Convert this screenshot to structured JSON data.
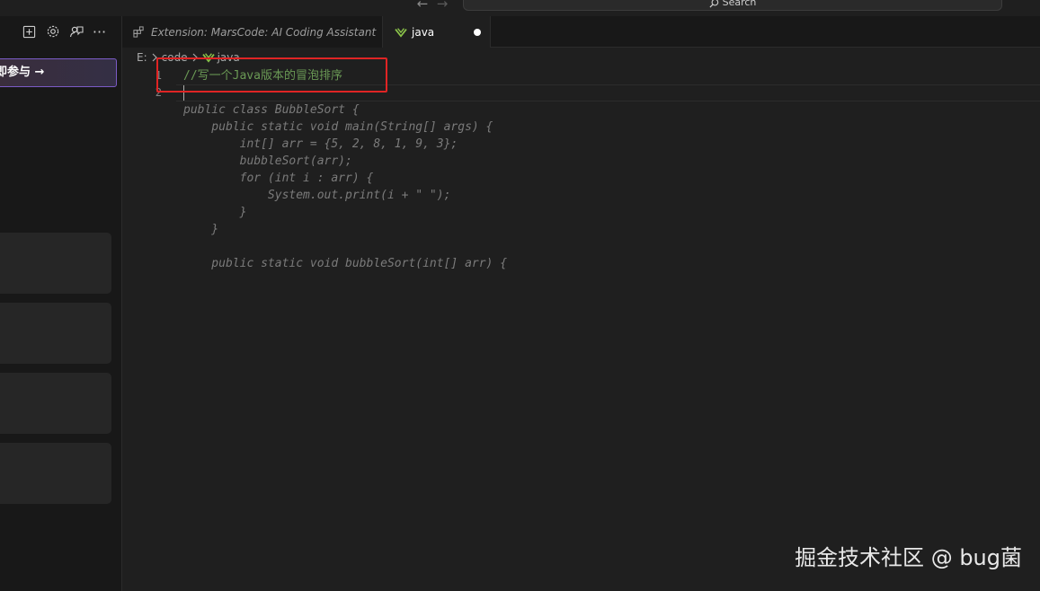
{
  "titlebar": {
    "back_arrow": "←",
    "forward_arrow": "→",
    "search_placeholder": "Search"
  },
  "sidebar": {
    "join_label": "即参与 →",
    "action_icons": [
      "new-file-icon",
      "settings-icon",
      "feedback-icon",
      "more-icon"
    ],
    "more_label": "···"
  },
  "tabs": [
    {
      "label": "Extension: MarsCode: AI Coding Assistant",
      "icon": "extension-icon",
      "active": false
    },
    {
      "label": "java",
      "icon": "java-icon",
      "active": true,
      "dirty": true
    }
  ],
  "breadcrumb": {
    "drive": "E:",
    "folder": "code",
    "file": "java"
  },
  "editor": {
    "line_numbers": [
      "1",
      "2"
    ],
    "comment": "//写一个Java版本的冒泡排序",
    "suggestion_lines": [
      "public class BubbleSort {",
      "    public static void main(String[] args) {",
      "        int[] arr = {5, 2, 8, 1, 9, 3};",
      "        bubbleSort(arr);",
      "        for (int i : arr) {",
      "            System.out.print(i + \" \");",
      "        }",
      "    }",
      "",
      "    public static void bubbleSort(int[] arr) {"
    ]
  },
  "colors": {
    "accent_border": "#7b5bc6",
    "highlight_box": "#e02424",
    "comment": "#6a9955",
    "java_icon": "#8bc34a"
  },
  "watermark": "掘金技术社区 @ bug菌"
}
